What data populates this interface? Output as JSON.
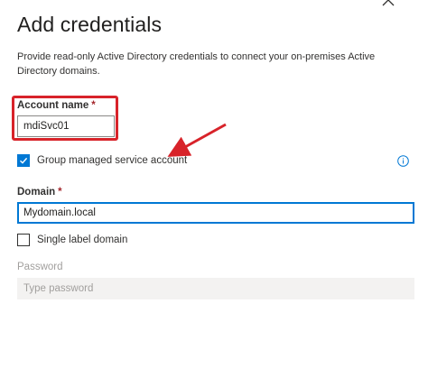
{
  "dialog": {
    "title": "Add credentials",
    "description": "Provide read-only Active Directory credentials to connect your on-premises Active Directory domains."
  },
  "account_name": {
    "label": "Account name",
    "required_marker": "*",
    "value": "mdiSvc01"
  },
  "gmsa": {
    "label": "Group managed service account",
    "checked": true
  },
  "domain": {
    "label": "Domain",
    "required_marker": "*",
    "value": "Mydomain.local"
  },
  "single_label": {
    "label": "Single label domain",
    "checked": false
  },
  "password": {
    "label": "Password",
    "placeholder": "Type password",
    "disabled": true
  },
  "icons": {
    "close": "close-icon",
    "info": "info-icon",
    "check": "checkmark-icon"
  },
  "colors": {
    "accent": "#0078d4",
    "annotation_red": "#d8232a",
    "required": "#a4262c"
  }
}
